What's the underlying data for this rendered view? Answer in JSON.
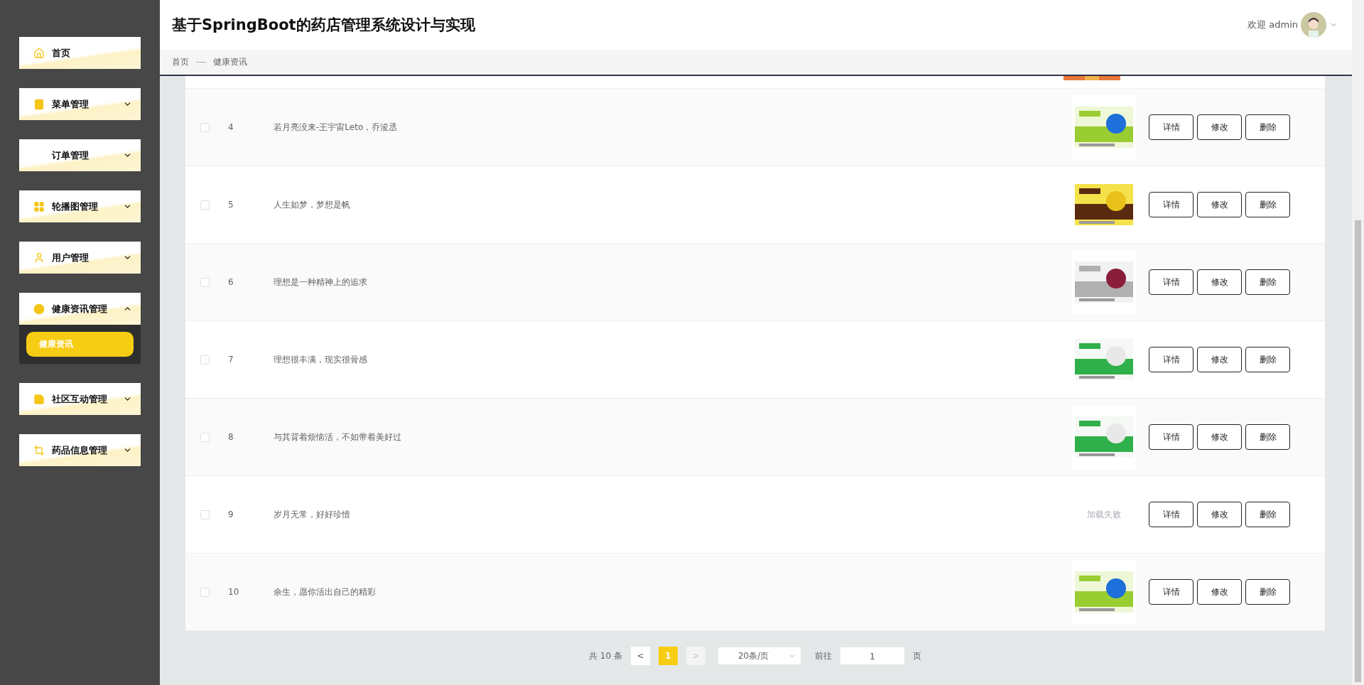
{
  "header": {
    "title": "基于SpringBoot的药店管理系统设计与实现",
    "welcome": "欢迎 admin"
  },
  "breadcrumb": [
    "首页",
    "健康资讯"
  ],
  "sidebar": {
    "items": [
      {
        "label": "首页",
        "kind": "link"
      },
      {
        "label": "菜单管理",
        "kind": "menu",
        "expanded": false
      },
      {
        "label": "订单管理",
        "kind": "menu",
        "expanded": false
      },
      {
        "label": "轮播图管理",
        "kind": "menu",
        "expanded": false
      },
      {
        "label": "用户管理",
        "kind": "menu",
        "expanded": false
      },
      {
        "label": "健康资讯管理",
        "kind": "menu",
        "expanded": true,
        "children": [
          {
            "label": "健康资讯",
            "selected": true
          }
        ]
      },
      {
        "label": "社区互动管理",
        "kind": "menu",
        "expanded": false
      },
      {
        "label": "药品信息管理",
        "kind": "menu",
        "expanded": false
      }
    ]
  },
  "table": {
    "rows": [
      {
        "index": "4",
        "title": "若月亮没来-王宇宙Leto，乔浚丞",
        "checked": false,
        "actions": [
          "详情",
          "修改",
          "删除"
        ]
      },
      {
        "index": "5",
        "title": "人生如梦，梦想是帆",
        "checked": false,
        "actions": [
          "详情",
          "修改",
          "删除"
        ]
      },
      {
        "index": "6",
        "title": "理想是一种精神上的追求",
        "checked": false,
        "actions": [
          "详情",
          "修改",
          "删除"
        ]
      },
      {
        "index": "7",
        "title": "理想很丰满，现实很骨感",
        "checked": false,
        "actions": [
          "详情",
          "修改",
          "删除"
        ]
      },
      {
        "index": "8",
        "title": "与其背着烦恼活，不如带着美好过",
        "checked": false,
        "actions": [
          "详情",
          "修改",
          "删除"
        ]
      },
      {
        "index": "9",
        "title": "岁月无常，好好珍惜",
        "checked": false,
        "image": {
          "kind": "error",
          "text": "加载失败"
        },
        "actions": [
          "详情",
          "修改",
          "删除"
        ]
      },
      {
        "index": "10",
        "title": "余生，愿你活出自己的精彩",
        "checked": false,
        "actions": [
          "详情",
          "修改",
          "删除"
        ]
      }
    ]
  },
  "pagination": {
    "total": "共 10 条",
    "prev": "<",
    "pages": [
      {
        "label": "1",
        "selected": true
      }
    ],
    "next": ">",
    "page_size": "20条/页",
    "goto_label": "前往",
    "goto_value": "1",
    "goto_suffix": "页"
  }
}
